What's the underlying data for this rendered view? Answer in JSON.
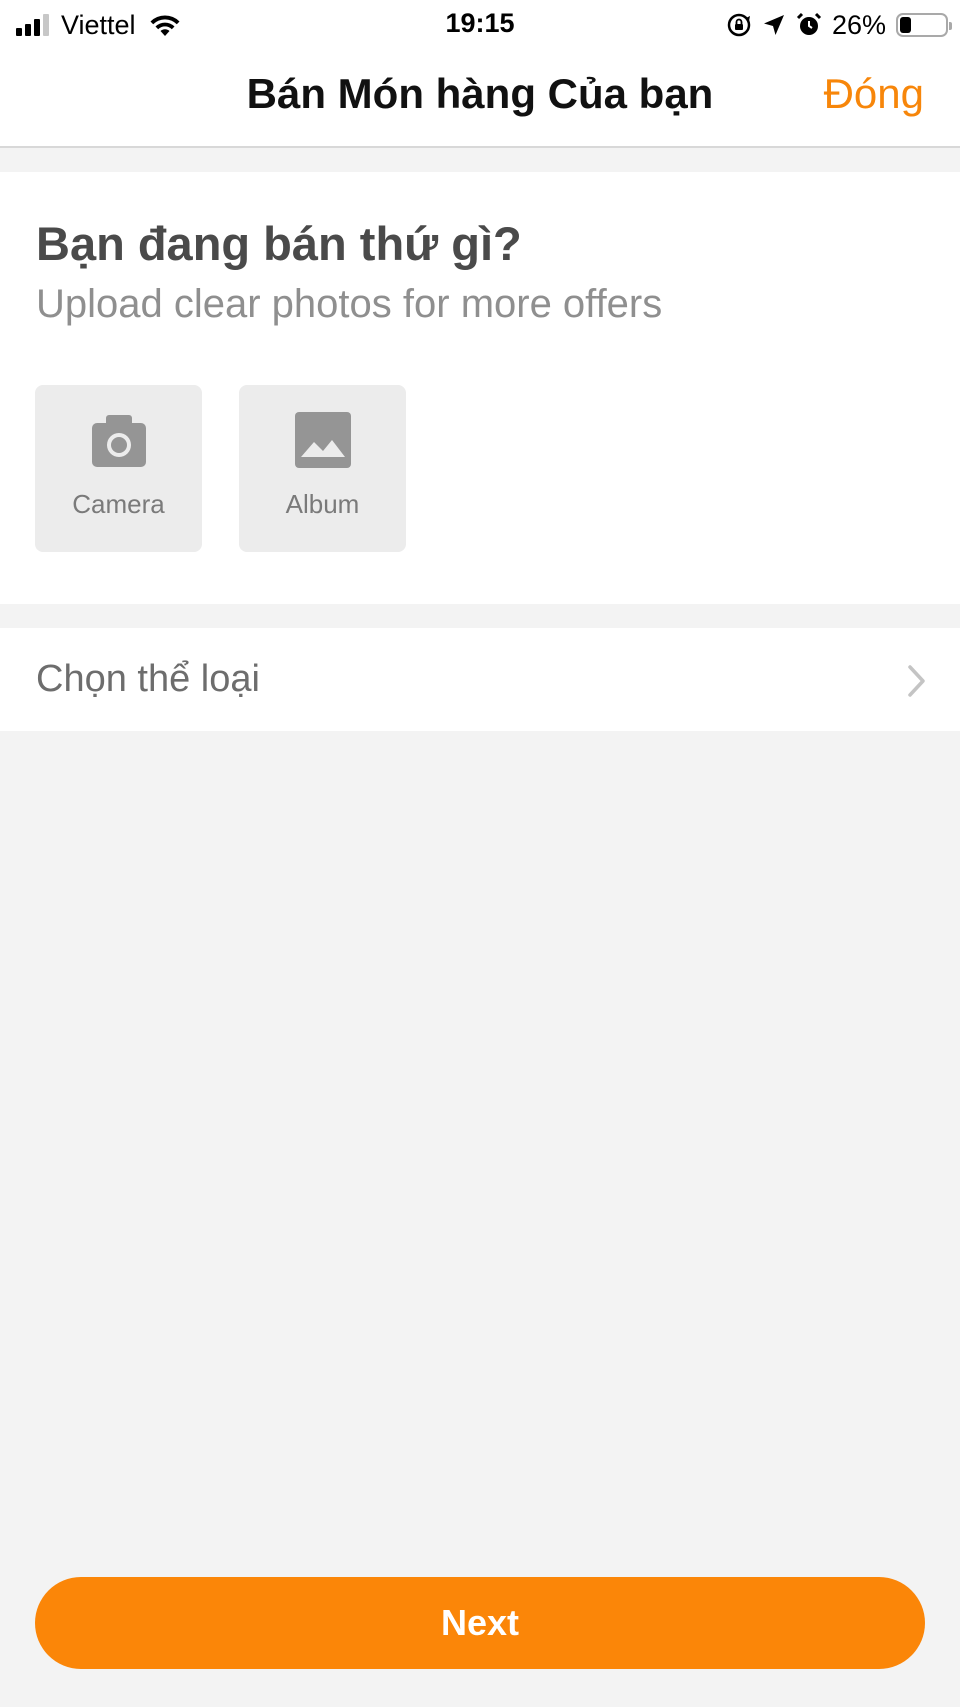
{
  "status_bar": {
    "carrier": "Viettel",
    "time": "19:15",
    "battery_percent": "26%",
    "battery_level": 0.26,
    "icons": [
      "signal-icon",
      "wifi-icon",
      "orientation-lock-icon",
      "location-icon",
      "alarm-icon",
      "battery-icon"
    ]
  },
  "nav": {
    "title": "Bán Món hàng Của bạn",
    "close_label": "Đóng",
    "accent_color": "#f7860a"
  },
  "photo_section": {
    "heading": "Bạn đang bán thứ gì?",
    "subheading": "Upload clear photos for more offers",
    "options": [
      {
        "label": "Camera",
        "icon": "camera-icon"
      },
      {
        "label": "Album",
        "icon": "image-icon"
      }
    ]
  },
  "category": {
    "label": "Chọn thể loại",
    "icon": "chevron-right-icon"
  },
  "footer": {
    "next_label": "Next",
    "button_color": "#fb8608"
  }
}
